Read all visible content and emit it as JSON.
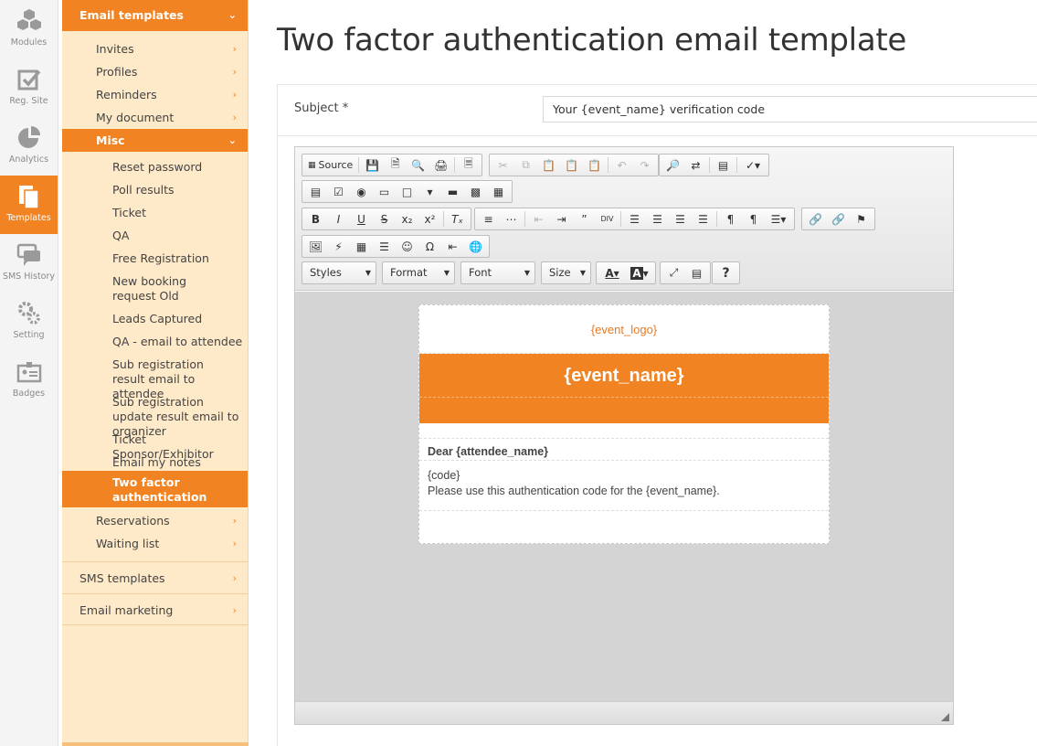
{
  "rail": [
    {
      "label": "Modules",
      "icon": "cubes-icon"
    },
    {
      "label": "Reg. Site",
      "icon": "checkbox-icon"
    },
    {
      "label": "Analytics",
      "icon": "pie-chart-icon"
    },
    {
      "label": "Templates",
      "icon": "documents-icon",
      "active": true
    },
    {
      "label": "SMS History",
      "icon": "chat-bubbles-icon"
    },
    {
      "label": "Setting",
      "icon": "gears-icon"
    },
    {
      "label": "Badges",
      "icon": "badge-icon"
    }
  ],
  "sidebar": {
    "email_templates": "Email templates",
    "invites": "Invites",
    "profiles": "Profiles",
    "reminders": "Reminders",
    "my_document": "My document",
    "misc": "Misc",
    "misc_items": [
      "Reset password",
      "Poll results",
      "Ticket",
      "QA",
      "Free Registration",
      "New booking request Old",
      "Leads Captured",
      "QA - email to attendee",
      "Sub registration result email to attendee",
      "Sub registration update result email to organizer",
      "Ticket Sponsor/Exhibitor",
      "Email my notes",
      "Two factor authentication"
    ],
    "reservations": "Reservations",
    "waiting_list": "Waiting list",
    "sms_templates": "SMS templates",
    "email_marketing": "Email marketing"
  },
  "page": {
    "title": "Two factor authentication email template",
    "subject_label": "Subject *",
    "subject_value": "Your {event_name} verification code"
  },
  "editor": {
    "source_label": "Source",
    "styles": "Styles",
    "format": "Format",
    "font": "Font",
    "size": "Size",
    "help": "?"
  },
  "email": {
    "logo": "{event_logo}",
    "event_name": "{event_name}",
    "dear": "Dear {attendee_name}",
    "code": "{code}",
    "body": "Please use this authentication code for the {event_name}."
  },
  "colors": {
    "accent": "#f28322",
    "sidebar_bg": "#fee9c8"
  }
}
